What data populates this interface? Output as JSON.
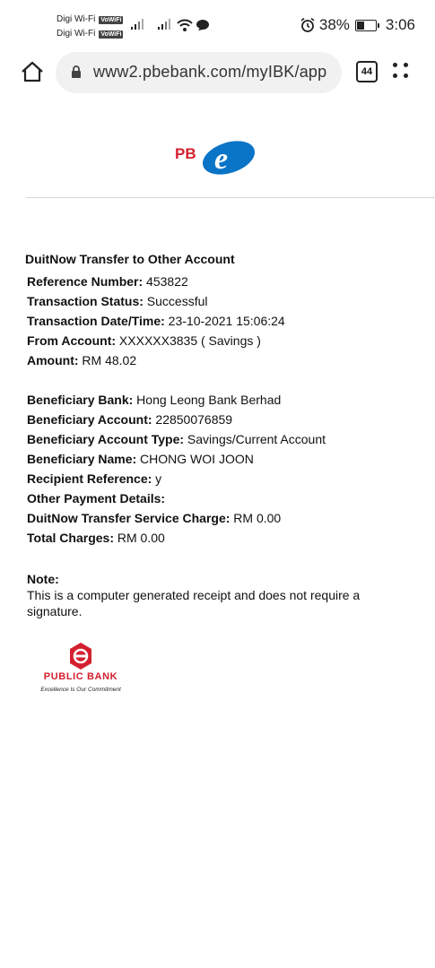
{
  "status_bar": {
    "carrier_1": "Digi Wi-Fi",
    "carrier_2": "Digi Wi-Fi",
    "vowifi_badge": "VoWiFi",
    "battery": "38%",
    "time": "3:06"
  },
  "browser": {
    "url": "www2.pbebank.com/myIBK/app",
    "tab_count": "44"
  },
  "logos": {
    "pbe_text": "PB",
    "pbe_mark": "e",
    "public_bank_name": "PUBLIC BANK",
    "public_bank_tagline": "Excellence Is Our Commitment",
    "brand_red": "#d4202f",
    "brand_blue": "#0a74c7"
  },
  "receipt": {
    "title": "DuitNow Transfer to Other Account",
    "fields_1": [
      {
        "label": "Reference Number:",
        "value": " 453822"
      },
      {
        "label": "Transaction Status:",
        "value": " Successful"
      },
      {
        "label": "Transaction Date/Time:",
        "value": " 23-10-2021 15:06:24"
      },
      {
        "label": "From Account:",
        "value": " XXXXXX3835 ( Savings )"
      },
      {
        "label": "Amount:",
        "value": " RM 48.02"
      }
    ],
    "fields_2": [
      {
        "label": "Beneficiary Bank:",
        "value": " Hong Leong Bank Berhad"
      },
      {
        "label": "Beneficiary Account:",
        "value": " 22850076859"
      },
      {
        "label": "Beneficiary Account Type:",
        "value": " Savings/Current Account"
      },
      {
        "label": "Beneficiary Name:",
        "value": " CHONG WOI JOON"
      },
      {
        "label": "Recipient Reference:",
        "value": " y"
      },
      {
        "label": "Other Payment Details:",
        "value": ""
      },
      {
        "label": "DuitNow Transfer Service Charge:",
        "value": " RM 0.00"
      },
      {
        "label": "Total Charges:",
        "value": " RM 0.00"
      }
    ],
    "note_label": "Note:",
    "note_text": "This is a computer generated receipt and does not require a signature."
  }
}
